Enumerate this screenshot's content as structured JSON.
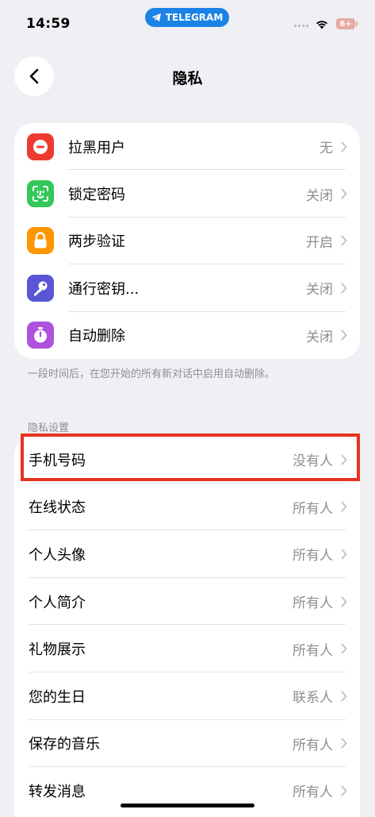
{
  "status_bar": {
    "time": "14:59",
    "pill_label": "TELEGRAM",
    "battery": "6+"
  },
  "header": {
    "title": "隐私"
  },
  "security_items": [
    {
      "label": "拉黑用户",
      "value": "无",
      "icon": "block-icon",
      "color": "#ee3b32"
    },
    {
      "label": "锁定密码",
      "value": "关闭",
      "icon": "face-id-icon",
      "color": "#34c759"
    },
    {
      "label": "两步验证",
      "value": "开启",
      "icon": "lock-icon",
      "color": "#ff9500"
    },
    {
      "label": "通行密钥...",
      "value": "关闭",
      "icon": "key-icon",
      "color": "#5856d6"
    },
    {
      "label": "自动删除",
      "value": "关闭",
      "icon": "timer-icon",
      "color": "#af52de"
    }
  ],
  "footnote": "一段时间后，在您开始的所有新对话中启用自动删除。",
  "privacy_section": {
    "header": "隐私设置",
    "items": [
      {
        "label": "手机号码",
        "value": "没有人"
      },
      {
        "label": "在线状态",
        "value": "所有人"
      },
      {
        "label": "个人头像",
        "value": "所有人"
      },
      {
        "label": "个人简介",
        "value": "所有人"
      },
      {
        "label": "礼物展示",
        "value": "所有人"
      },
      {
        "label": "您的生日",
        "value": "联系人"
      },
      {
        "label": "保存的音乐",
        "value": "所有人"
      },
      {
        "label": "转发消息",
        "value": "所有人"
      }
    ]
  },
  "colors": {
    "background": "#efeff4",
    "highlight": "#e8321f",
    "accent": "#1b83e6"
  }
}
